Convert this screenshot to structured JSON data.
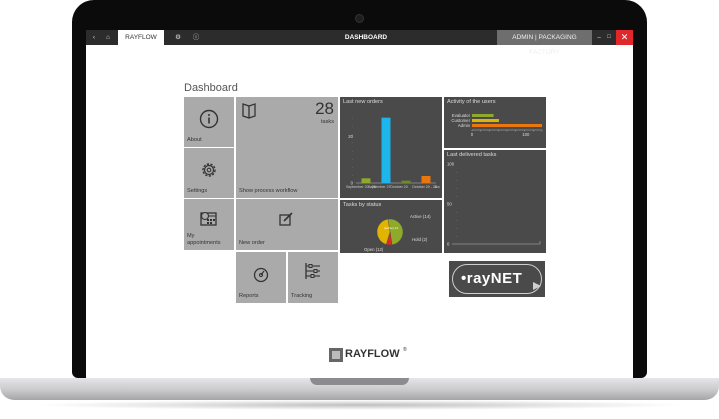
{
  "titlebar": {
    "tab_label": "RAYFLOW",
    "title": "DASHBOARD",
    "context": "ADMIN | PACKAGING FACTORY",
    "icons": [
      "back-arrow-icon",
      "home-icon",
      "settings-gear-icon",
      "info-icon",
      "minimize-icon",
      "maximize-icon",
      "close-icon"
    ]
  },
  "dashboard": {
    "heading": "Dashboard",
    "tiles": {
      "about": "About",
      "settings": "Settings",
      "appointments_line1": "My",
      "appointments_line2": "appointments",
      "workflow_label": "Show process workflow",
      "workflow_count": "28",
      "workflow_unit": "tasks",
      "new_order": "New order",
      "reports": "Reports",
      "tracking": "Tracking"
    },
    "panels": {
      "last_orders_title": "Last new orders",
      "activity_title": "Activity of the users",
      "delivered_title": "Last delivered tasks",
      "status_title": "Tasks by status"
    }
  },
  "chart_data": [
    {
      "type": "bar",
      "title": "Last new orders",
      "y_ticks": [
        "0",
        "20"
      ],
      "x_tick_labels": [
        "September 20 - 26",
        "September 27",
        "October 20",
        "October 20 - 26",
        "Jun"
      ],
      "values": [
        2,
        28,
        1,
        3
      ],
      "colors": [
        "#8faa2b",
        "#1eb6ea",
        "#6c8c2a",
        "#e9770e"
      ],
      "ylim": [
        0,
        30
      ]
    },
    {
      "type": "bar",
      "orientation": "horizontal",
      "title": "Activity of the users",
      "categories": [
        "Evaluator",
        "Customer",
        "Admin"
      ],
      "values": [
        40,
        50,
        130
      ],
      "colors": [
        "#8faa2b",
        "#e0b400",
        "#e9770e"
      ],
      "x_ticks": [
        "0",
        "100"
      ],
      "xlim": [
        0,
        130
      ]
    },
    {
      "type": "line",
      "title": "Last delivered tasks",
      "y_ticks": [
        "0",
        "50",
        "100"
      ],
      "ylim": [
        0,
        100
      ]
    },
    {
      "type": "pie",
      "title": "Tasks by status",
      "slices": [
        {
          "label": "Active (14)",
          "value": 14,
          "color": "#8faa2b"
        },
        {
          "label": "Hold (2)",
          "value": 2,
          "color": "#e0282a"
        },
        {
          "label": "Open (12)",
          "value": 12,
          "color": "#e0b400"
        }
      ],
      "center_label": "(active) 14"
    }
  ],
  "footer": {
    "logo_text": "RAYFLOW",
    "logo_mark": "®"
  },
  "raynet_logo": "•rayNET",
  "colors": {
    "tile": "#aaaaaa",
    "panel": "#4a4a4a",
    "accent_blue": "#1eb6ea",
    "accent_orange": "#e9770e",
    "accent_green": "#8faa2b",
    "accent_yellow": "#e0b400"
  }
}
